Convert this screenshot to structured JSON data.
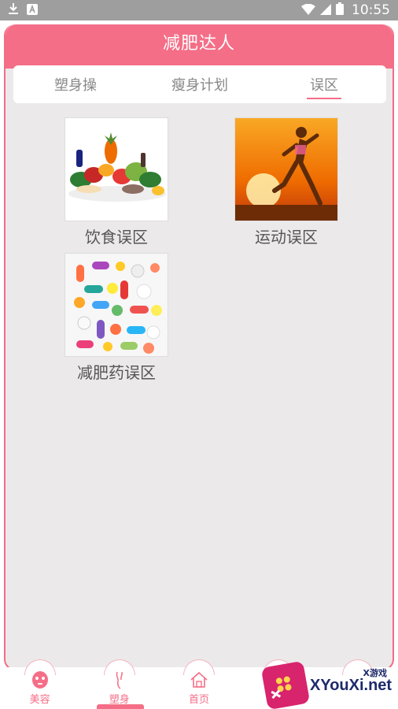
{
  "status_bar": {
    "time": "10:55"
  },
  "header": {
    "title": "减肥达人"
  },
  "tabs": [
    {
      "label": "塑身操",
      "active": false
    },
    {
      "label": "瘦身计划",
      "active": false
    },
    {
      "label": "误区",
      "active": true
    }
  ],
  "items": [
    {
      "label": "饮食误区",
      "image": "vegetables-image"
    },
    {
      "label": "运动误区",
      "image": "runner-image"
    },
    {
      "label": "减肥药误区",
      "image": "pills-image"
    }
  ],
  "bottom_nav": [
    {
      "label": "美容",
      "icon": "face-mask-icon"
    },
    {
      "label": "塑身",
      "icon": "body-icon"
    },
    {
      "label": "首页",
      "icon": "home-icon"
    }
  ],
  "watermark": {
    "text": "XYouXi.net",
    "sub": "X游戏"
  },
  "colors": {
    "accent": "#f56e87",
    "background": "#ece9ea"
  }
}
